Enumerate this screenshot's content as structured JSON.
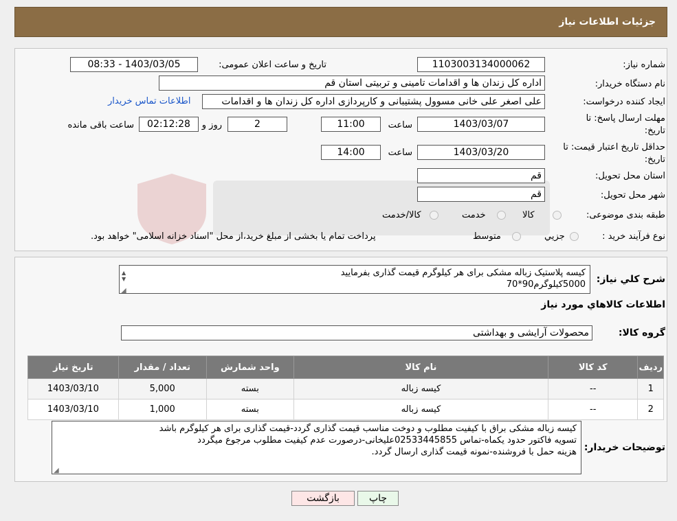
{
  "header": {
    "title": "جزئیات اطلاعات نیاز"
  },
  "labels": {
    "need_number": "شماره نیاز:",
    "announce_datetime": "تاریخ و ساعت اعلان عمومی:",
    "buyer_org": "نام دستگاه خریدار:",
    "requester": "ایجاد کننده درخواست:",
    "send_deadline": "مهلت ارسال پاسخ: تا تاریخ:",
    "send_deadline_l1": "مهلت ارسال پاسخ: تا",
    "send_deadline_l2": "تاریخ:",
    "price_validity_l1": "حداقل تاریخ اعتبار قیمت: تا",
    "price_validity_l2": "تاریخ:",
    "time": "ساعت",
    "day_and": "روز و",
    "remaining": "ساعت باقی مانده",
    "delivery_province": "استان محل تحویل:",
    "delivery_city": "شهر محل تحویل:",
    "category": "طبقه بندی موضوعی:",
    "purchase_type": "نوع فرآیند خرید :",
    "general_desc": "شرح کلي نياز:",
    "goods_info": "اطلاعات کالاهاي مورد نياز",
    "goods_group": "گروه کالا:",
    "buyer_notes": "توضیحات خریدار:"
  },
  "values": {
    "need_number": "1103003134000062",
    "announce_datetime": "1403/03/05 - 08:33",
    "buyer_org": "اداره کل زندان ها و اقدامات تامینی و تربیتی استان قم",
    "requester": "علی اصغر علی خانی مسوول پشتیبانی و کارپردازی اداره کل زندان ها و اقدامات",
    "contact_link": "اطلاعات تماس خریدار",
    "send_date": "1403/03/07",
    "send_time": "11:00",
    "days": "2",
    "remaining_time": "02:12:28",
    "validity_date": "1403/03/20",
    "validity_time": "14:00",
    "province": "قم",
    "city": "قم",
    "goods_group": "محصولات آرایشی و بهداشتی",
    "desc_line1": "کیسه پلاستیک زباله مشکی برای هر کیلوگرم قیمت گذاری بفرمایید",
    "desc_line2": "5000کیلوگرم90*70",
    "notes_line1": "کیسه زباله مشکی براق با کیفیت مطلوب و دوخت مناسب  قیمت گذاری گردد-قیمت گذاری برای هر کیلوگرم باشد",
    "notes_line2": "تسویه فاکتور حدود یکماه-تماس 02533445855علیخانی-درصورت عدم کیفیت مطلوب مرجوع میگردد",
    "notes_line3": "هزینه حمل با فروشنده-نمونه قیمت گذاری ارسال گردد."
  },
  "category_options": [
    "کالا",
    "خدمت",
    "کالا/خدمت"
  ],
  "purchase_options": [
    "جزیي",
    "متوسط"
  ],
  "purchase_note": "پرداخت تمام یا بخشی از مبلغ خرید،از محل \"اسناد خزانه اسلامی\" خواهد بود.",
  "table": {
    "headers": [
      "ردیف",
      "کد کالا",
      "نام کالا",
      "واحد شمارش",
      "تعداد / مقدار",
      "تاریخ نیاز"
    ],
    "rows": [
      [
        "1",
        "--",
        "کیسه زباله",
        "بسته",
        "5,000",
        "1403/03/10"
      ],
      [
        "2",
        "--",
        "کیسه زباله",
        "بسته",
        "1,000",
        "1403/03/10"
      ]
    ]
  },
  "buttons": {
    "print": "چاپ",
    "back": "بازگشت"
  },
  "colors": {
    "header_bg": "#8b6d45",
    "table_header_bg": "#7a7a7a",
    "link": "#1a56c9",
    "back_button_bg": "#fde6e6",
    "print_button_bg": "#e9f8e9"
  }
}
